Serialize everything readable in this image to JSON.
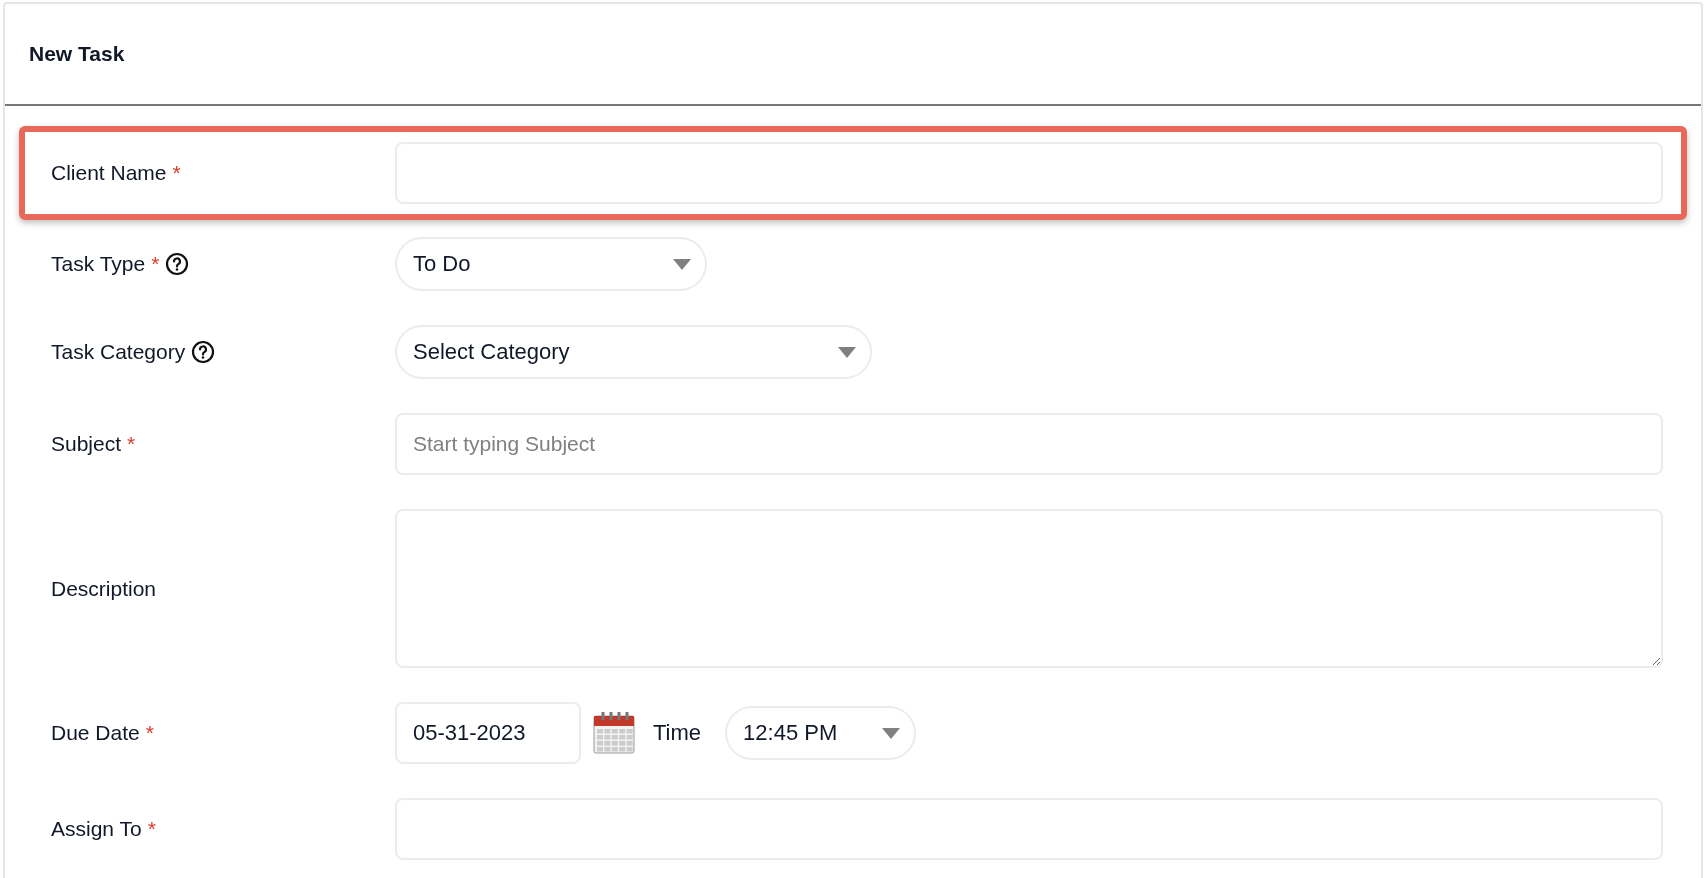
{
  "panel": {
    "title": "New Task"
  },
  "fields": [
    {
      "kind": "text",
      "label": "Client Name",
      "required_mark": "*",
      "help": false,
      "highlighted": true
    },
    {
      "kind": "select",
      "label": "Task Type",
      "required_mark": "*",
      "help": true,
      "highlighted": false,
      "value": "To Do"
    },
    {
      "kind": "select",
      "label": "Task Category",
      "help": true,
      "highlighted": false,
      "value": "Select Category"
    },
    {
      "kind": "text",
      "label": "Subject",
      "required_mark": "*",
      "help": false,
      "highlighted": false,
      "placeholder": "Start typing Subject"
    },
    {
      "kind": "textarea",
      "label": "Description",
      "help": false,
      "highlighted": false
    },
    {
      "kind": "datetime",
      "label": "Due Date",
      "required_mark": "*",
      "help": false,
      "highlighted": false,
      "value": "05-31-2023",
      "time_label": "Time",
      "time_value": "12:45 PM"
    },
    {
      "kind": "text",
      "label": "Assign To",
      "required_mark": "*",
      "help": false,
      "highlighted": false
    }
  ]
}
